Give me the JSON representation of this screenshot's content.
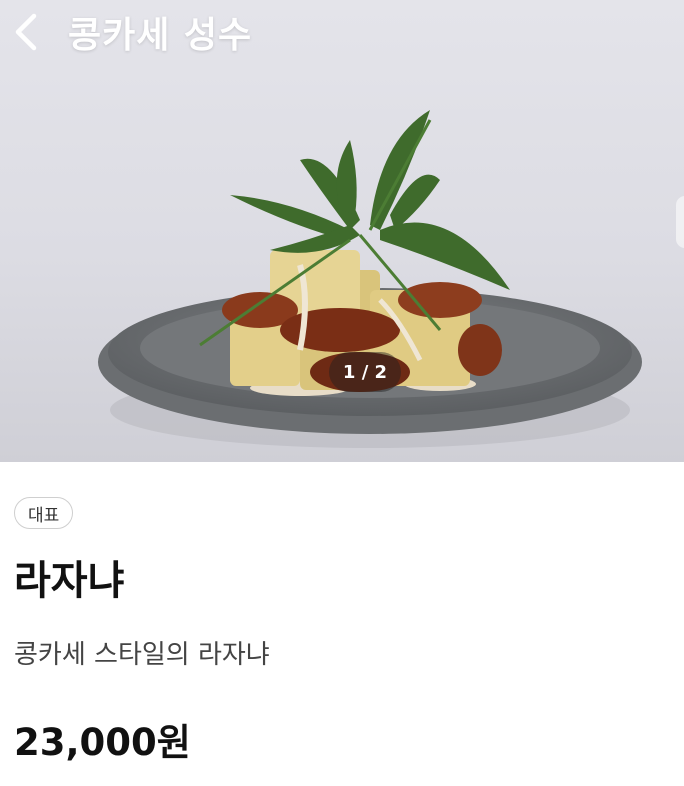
{
  "header": {
    "store_name": "콩카세 성수"
  },
  "image_counter": "1 / 2",
  "menu": {
    "badge": "대표",
    "name": "라자냐",
    "description": "콩카세 스타일의 라자냐",
    "price": "23,000원"
  },
  "icons": {
    "back": "chevron-left-icon"
  }
}
